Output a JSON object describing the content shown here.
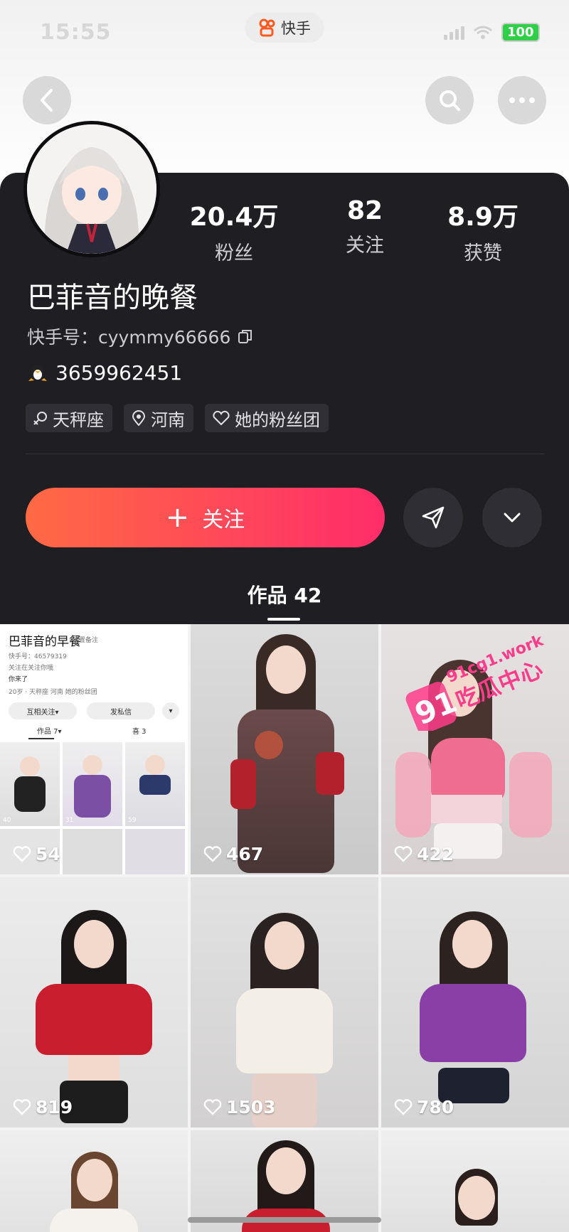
{
  "status_bar": {
    "time": "15:55",
    "app_name": "快手",
    "battery": "100"
  },
  "profile": {
    "nickname": "巴菲音的晚餐",
    "kuaishou_id": "快手号：cyymmy66666",
    "qq": "3659962451",
    "stats": [
      {
        "value": "20.4万",
        "label": "粉丝"
      },
      {
        "value": "82",
        "label": "关注"
      },
      {
        "value": "8.9万",
        "label": "获赞"
      }
    ],
    "tags": [
      "天秤座",
      "河南",
      "她的粉丝团"
    ]
  },
  "actions": {
    "follow_label": "关注",
    "plus_symbol": "+"
  },
  "works_tab": "作品 42",
  "videos": [
    {
      "likes": "54"
    },
    {
      "likes": "467"
    },
    {
      "likes": "422"
    },
    {
      "likes": "819"
    },
    {
      "likes": "1503"
    },
    {
      "likes": "780"
    },
    {
      "likes": ""
    },
    {
      "likes": ""
    },
    {
      "likes": ""
    }
  ],
  "mini_screenshot": {
    "title": "巴菲音的早餐",
    "remark": "设置备注",
    "id": "快手号：46579319",
    "line1": "关注在关注你哦",
    "line2": "你来了",
    "tags": "20岁 · 天秤座  河南  她的粉丝团",
    "btn1": "互相关注▾",
    "btn2": "发私信",
    "tab1": "作品 7▾",
    "tab2": "喜 3",
    "thumb_likes": [
      "40",
      "31",
      "59"
    ]
  },
  "watermark": {
    "domain": "91cg1.work",
    "number": "91",
    "slogan": "吃瓜中心"
  },
  "icons": {
    "back": "chevron-left-icon",
    "search": "search-icon",
    "more": "more-icon",
    "copy": "copy-icon",
    "qq": "qq-penguin-icon",
    "constellation": "venus-icon",
    "location": "location-pin-icon",
    "fan_club": "heart-group-icon",
    "share": "send-icon",
    "expand": "chevron-down-icon",
    "like": "heart-icon"
  },
  "colors": {
    "panel": "#1e1e23",
    "follow_gradient_start": "#ff6a44",
    "follow_gradient_end": "#ff2d6a",
    "battery": "#2fcf47",
    "watermark": "#ff3d8b"
  }
}
